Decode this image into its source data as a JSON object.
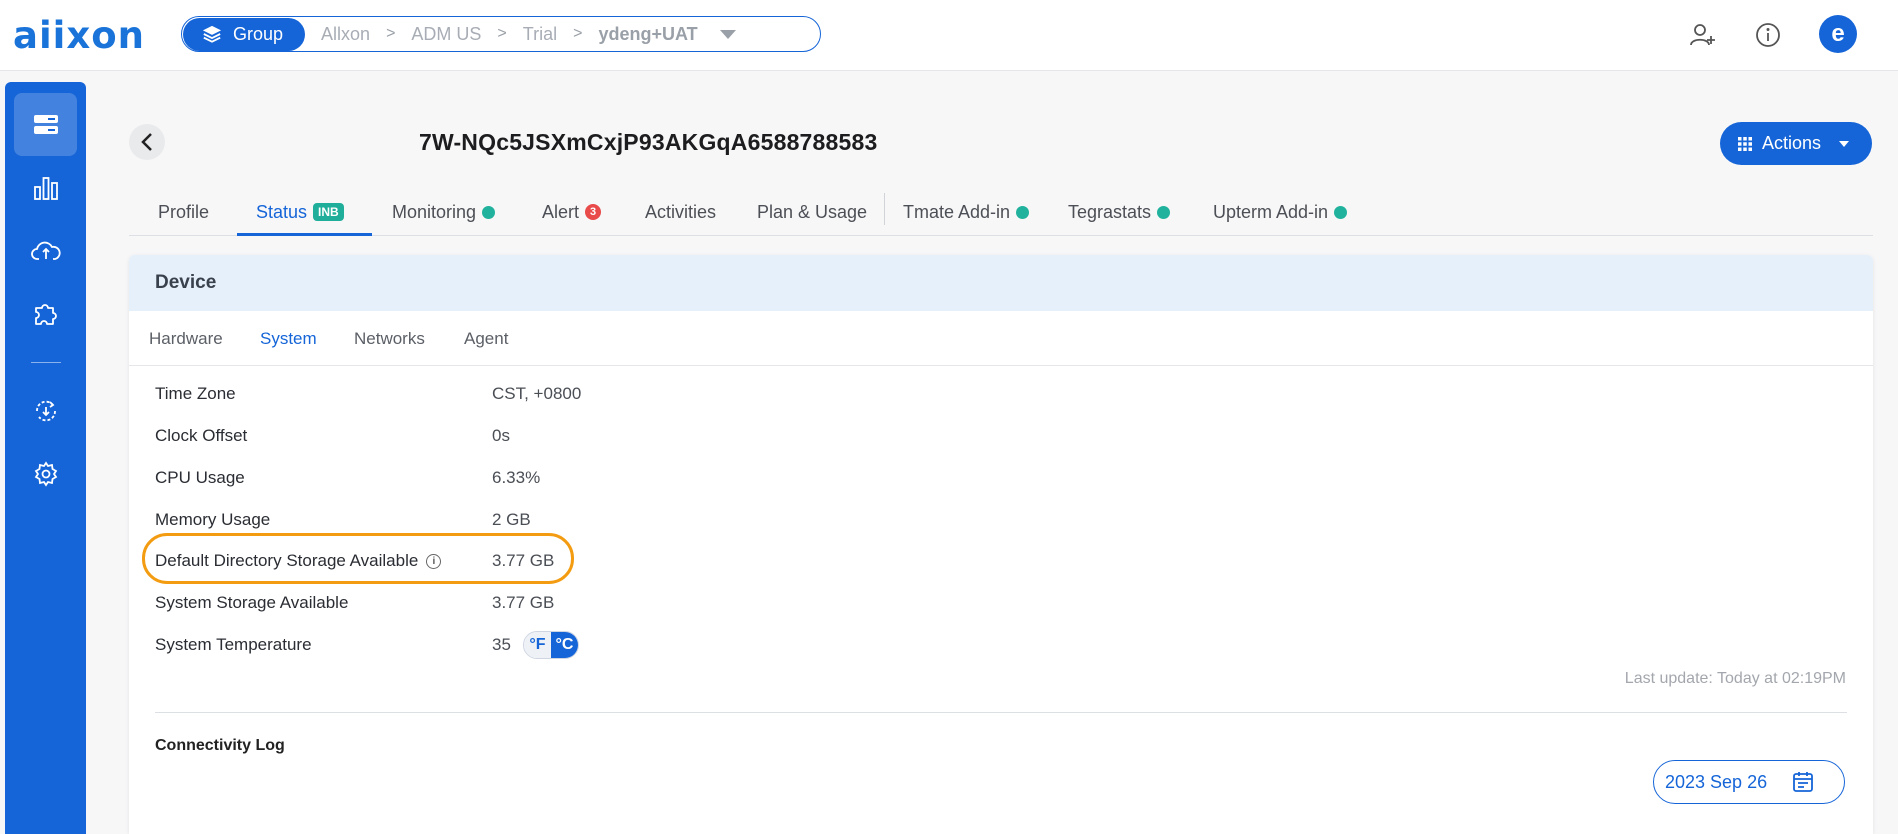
{
  "brand": {
    "logo_text": "aiixon",
    "accent": "#1565d8",
    "highlight": "#f39c12"
  },
  "breadcrumb": {
    "group_label": "Group",
    "items": [
      "Allxon",
      "ADM US",
      "Trial"
    ],
    "current": "ydeng+UAT"
  },
  "header": {
    "avatar_letter": "e",
    "device_name": "7W-NQc5JSXmCxjP93AKGqA6588788583",
    "actions_label": "Actions"
  },
  "tabs": {
    "profile": "Profile",
    "status": "Status",
    "status_badge": "INB",
    "monitoring": "Monitoring",
    "alert": "Alert",
    "alert_count": "3",
    "activities": "Activities",
    "plan_usage": "Plan & Usage",
    "tmate": "Tmate Add-in",
    "tegrastats": "Tegrastats",
    "upterm": "Upterm Add-in"
  },
  "card": {
    "title": "Device",
    "subtabs": [
      "Hardware",
      "System",
      "Networks",
      "Agent"
    ],
    "active_subtab": "System",
    "rows": [
      {
        "label": "Time Zone",
        "value": "CST, +0800"
      },
      {
        "label": "Clock Offset",
        "value": "0s"
      },
      {
        "label": "CPU Usage",
        "value": "6.33%"
      },
      {
        "label": "Memory Usage",
        "value": "2 GB"
      },
      {
        "label": "Default Directory Storage Available",
        "value": "3.77 GB",
        "info_icon": "i"
      },
      {
        "label": "System Storage Available",
        "value": "3.77 GB"
      },
      {
        "label": "System Temperature",
        "value": "35"
      }
    ],
    "temp_units": {
      "f": "°F",
      "c": "°C",
      "selected": "°C"
    },
    "last_update": "Last update: Today at 02:19PM",
    "connectivity_title": "Connectivity Log",
    "date_label": "2023 Sep 26"
  },
  "icons": {
    "sidebar": [
      "devices-icon",
      "bar-chart-icon",
      "cloud-sync-icon",
      "puzzle-icon",
      "ota-update-icon",
      "gear-icon"
    ],
    "top": [
      "add-user-icon",
      "info-icon"
    ]
  }
}
